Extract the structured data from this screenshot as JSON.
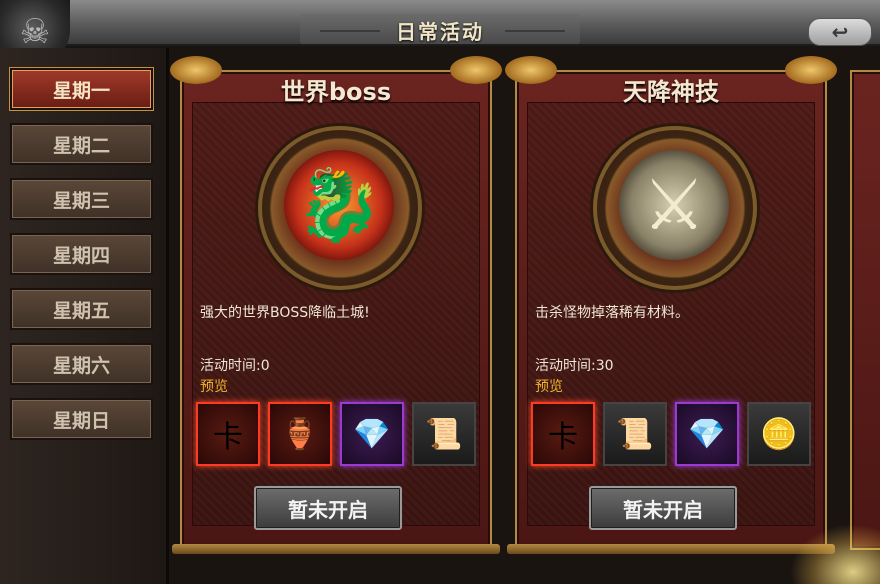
{
  "window": {
    "title": "日常活动",
    "back_glyph": "↩",
    "dragon_glyph": "☠"
  },
  "sidebar": {
    "items": [
      {
        "label": "星期一",
        "active": true
      },
      {
        "label": "星期二",
        "active": false
      },
      {
        "label": "星期三",
        "active": false
      },
      {
        "label": "星期四",
        "active": false
      },
      {
        "label": "星期五",
        "active": false
      },
      {
        "label": "星期六",
        "active": false
      },
      {
        "label": "星期日",
        "active": false
      }
    ]
  },
  "cards": [
    {
      "title": "世界boss",
      "emblem": "dragon-icon",
      "emblem_glyph": "🐉",
      "description": "强大的世界BOSS降临土城!",
      "time_label": "活动时间:",
      "time_value": "0",
      "preview_label": "预览",
      "items": [
        {
          "name": "recharge-card-icon",
          "glyph": "卡",
          "rarity": "red"
        },
        {
          "name": "bowl-icon",
          "glyph": "🏺",
          "rarity": "red"
        },
        {
          "name": "ruby-icon",
          "glyph": "💎",
          "rarity": "purple"
        },
        {
          "name": "scroll-red-icon",
          "glyph": "📜",
          "rarity": "dark"
        }
      ],
      "button_label": "暂未开启"
    },
    {
      "title": "天降神技",
      "emblem": "sword-guardian-icon",
      "emblem_glyph": "⚔",
      "description": "击杀怪物掉落稀有材料。",
      "time_label": "活动时间:",
      "time_value": "30",
      "preview_label": "预览",
      "items": [
        {
          "name": "recharge-card-icon",
          "glyph": "卡",
          "rarity": "red"
        },
        {
          "name": "scroll-icon",
          "glyph": "📜",
          "rarity": "dark"
        },
        {
          "name": "ruby-icon",
          "glyph": "💎",
          "rarity": "purple"
        },
        {
          "name": "gold-ingot-icon",
          "glyph": "🪙",
          "rarity": "dark"
        }
      ],
      "button_label": "暂未开启"
    }
  ],
  "colors": {
    "accent_gold": "#b38a44",
    "card_red": "#6b2420",
    "preview_text": "#f0b528",
    "active_tab": "#a03a2a"
  }
}
